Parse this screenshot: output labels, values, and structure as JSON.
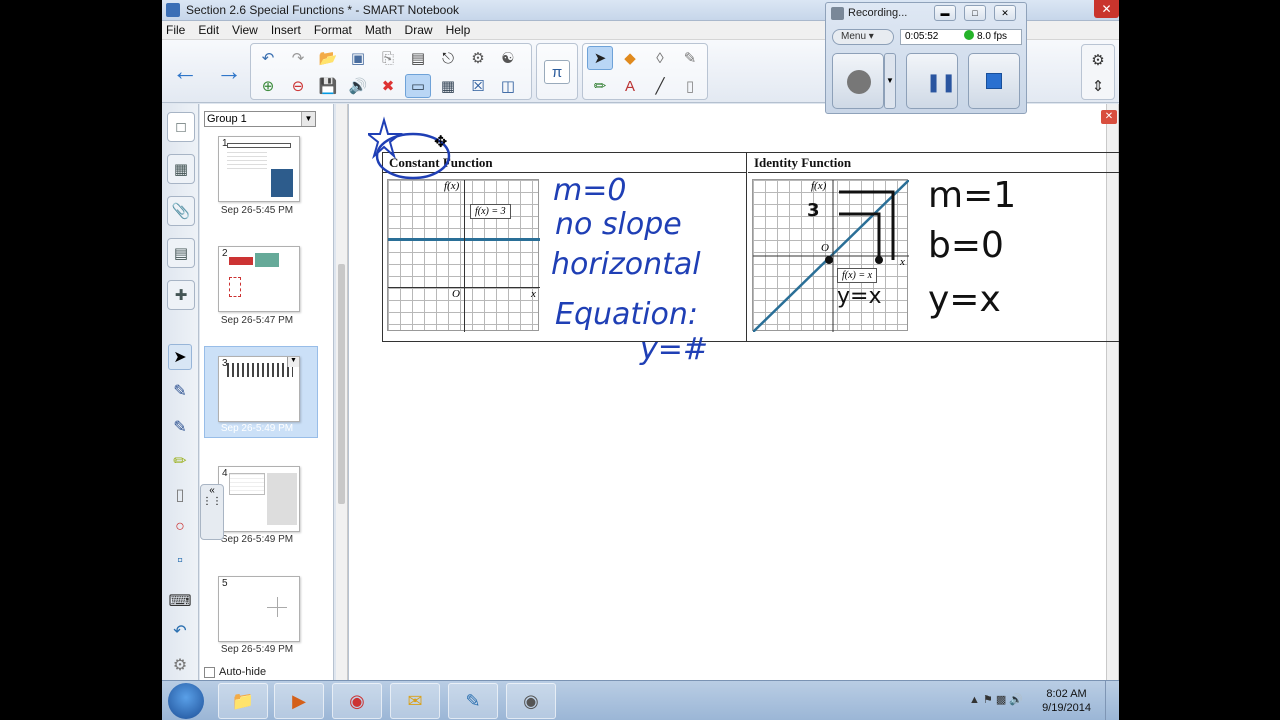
{
  "window": {
    "title": "Section 2.6 Special Functions * - SMART Notebook"
  },
  "menu": [
    "File",
    "Edit",
    "View",
    "Insert",
    "Format",
    "Math",
    "Draw",
    "Help"
  ],
  "sorter": {
    "group": "Group 1",
    "autohide_label": "Auto-hide",
    "pages": [
      {
        "num": "1",
        "time": "Sep 26-5:45 PM"
      },
      {
        "num": "2",
        "time": "Sep 26-5:47 PM"
      },
      {
        "num": "3",
        "time": "Sep 26-5:49 PM"
      },
      {
        "num": "4",
        "time": "Sep 26-5:49 PM"
      },
      {
        "num": "5",
        "time": "Sep 26-5:49 PM"
      }
    ]
  },
  "page": {
    "constant": {
      "heading": "Constant Function",
      "fx": "f(x)",
      "x": "x",
      "origin": "O",
      "callout": "f(x) = 3",
      "notes": [
        "m=0",
        "no slope",
        "horizontal",
        "Equation:",
        "y=#"
      ]
    },
    "identity": {
      "heading": "Identity Function",
      "fx": "f(x)",
      "x": "x",
      "origin": "O",
      "callout": "f(x) = x",
      "three": "3",
      "eq": "y=x",
      "notes": [
        "m=1",
        "b=0",
        "y=x"
      ]
    }
  },
  "recorder": {
    "title": "Recording...",
    "menu": "Menu",
    "time": "0:05:52",
    "fps": "8.0 fps"
  },
  "taskbar": {
    "time": "8:02 AM",
    "date": "9/19/2014"
  },
  "colors": {
    "ink_blue": "#1f3fb5",
    "graph_line": "#2a6f97",
    "record_dot": "#25b32a"
  }
}
